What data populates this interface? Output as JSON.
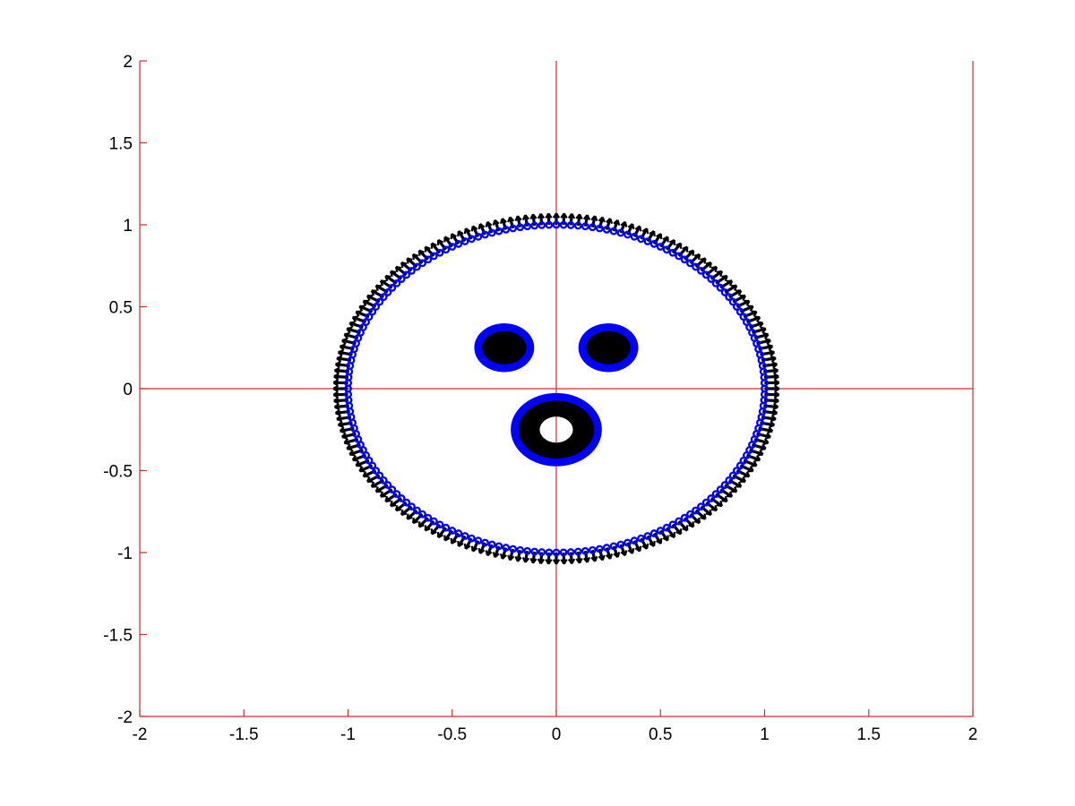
{
  "chart_data": {
    "type": "scatter",
    "title": "",
    "xlabel": "",
    "ylabel": "",
    "xlim": [
      -2,
      2
    ],
    "ylim": [
      -2,
      2
    ],
    "grid": false,
    "x_ticks": [
      -2,
      -1.5,
      -1,
      -0.5,
      0,
      0.5,
      1,
      1.5,
      2
    ],
    "y_ticks": [
      -2,
      -1.5,
      -1,
      -0.5,
      0,
      0.5,
      1,
      1.5,
      2
    ],
    "x_tick_labels": [
      "-2",
      "-1.5",
      "-1",
      "-0.5",
      "0",
      "0.5",
      "1",
      "1.5",
      "2"
    ],
    "y_tick_labels": [
      "-2",
      "-1.5",
      "-1",
      "-0.5",
      "0",
      "0.5",
      "1",
      "1.5",
      "2"
    ],
    "reference_lines": [
      {
        "orientation": "horizontal",
        "value": 0
      },
      {
        "orientation": "vertical",
        "value": 0
      },
      {
        "orientation": "vertical",
        "value": 2
      }
    ],
    "shapes": [
      {
        "name": "outer-boundary",
        "center": [
          0,
          0
        ],
        "radius": 1.0,
        "normal_length": 0.07,
        "normal_count": 180
      },
      {
        "name": "left-eye",
        "center": [
          -0.25,
          0.25
        ],
        "radius": 0.125,
        "normal_length": 0.125,
        "normal_count": 90
      },
      {
        "name": "right-eye",
        "center": [
          0.25,
          0.25
        ],
        "radius": 0.125,
        "normal_length": 0.125,
        "normal_count": 90
      },
      {
        "name": "mouth",
        "center": [
          0,
          -0.25
        ],
        "radius": 0.2,
        "normal_length": 0.12,
        "normal_count": 120
      }
    ]
  },
  "colors": {
    "axes": "#d42b2b",
    "boundary_points": "#0000ff",
    "normals": "#000000",
    "background": "#ffffff"
  }
}
